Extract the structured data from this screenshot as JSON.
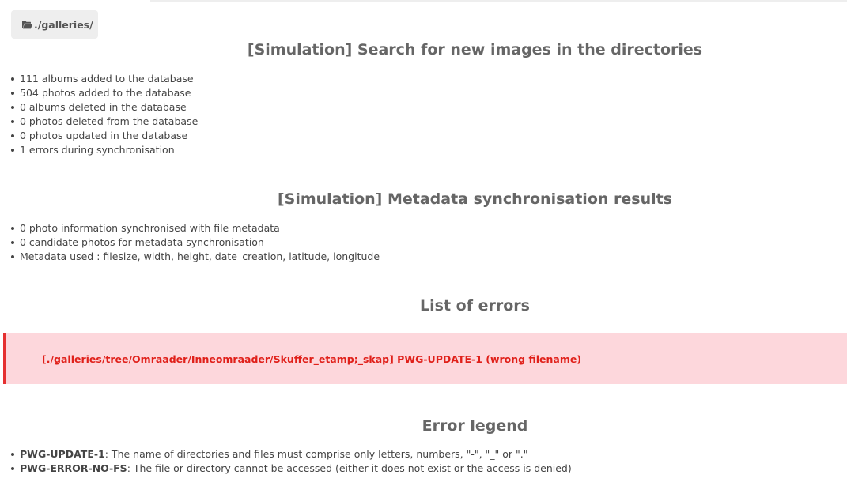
{
  "breadcrumb": {
    "icon": "folder-open-icon",
    "label": "./galleries/"
  },
  "search_section": {
    "title": "[Simulation] Search for new images in the directories",
    "items": [
      "111 albums added to the database",
      "504 photos added to the database",
      "0 albums deleted in the database",
      "0 photos deleted from the database",
      "0 photos updated in the database",
      "1 errors during synchronisation"
    ]
  },
  "metadata_section": {
    "title": "[Simulation] Metadata synchronisation results",
    "items": [
      "0 photo information synchronised with file metadata",
      "0 candidate photos for metadata synchronisation",
      "Metadata used : filesize, width, height, date_creation, latitude, longitude"
    ]
  },
  "errors_section": {
    "title": "List of errors",
    "errors": [
      "[./galleries/tree/Omraader/Inneomraader/Skuffer_etamp;_skap] PWG-UPDATE-1 (wrong filename)"
    ],
    "colors": {
      "background": "#fdd7dc",
      "border": "#e53030",
      "text": "#e0201a"
    }
  },
  "legend_section": {
    "title": "Error legend",
    "items": [
      {
        "code": "PWG-UPDATE-1",
        "description": ": The name of directories and files must comprise only letters, numbers, \"-\", \"_\" or \".\""
      },
      {
        "code": "PWG-ERROR-NO-FS",
        "description": ": The file or directory cannot be accessed (either it does not exist or the access is denied)"
      }
    ]
  }
}
